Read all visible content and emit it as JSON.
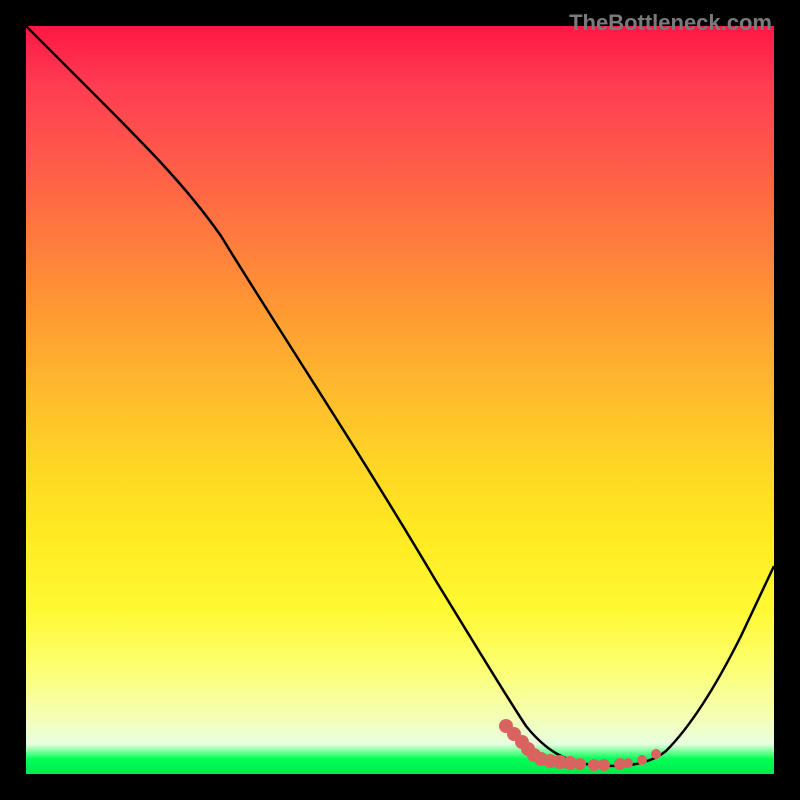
{
  "watermark": "TheBottleneck.com",
  "chart_data": {
    "type": "line",
    "title": "",
    "xlabel": "",
    "ylabel": "",
    "xlim": [
      0,
      100
    ],
    "ylim": [
      0,
      100
    ],
    "series": [
      {
        "name": "curve",
        "x": [
          0,
          8,
          18,
          30,
          45,
          58,
          64,
          70,
          73,
          76,
          80,
          84,
          88,
          92,
          100
        ],
        "y": [
          100,
          92,
          84,
          72,
          52,
          32,
          22,
          10,
          5,
          2,
          1,
          1,
          4,
          10,
          28
        ]
      }
    ],
    "trough_markers": {
      "x": [
        64,
        66,
        68,
        70,
        72,
        73,
        74,
        76,
        78,
        80,
        82,
        83
      ],
      "y": [
        5,
        4,
        3,
        3,
        2.5,
        2,
        1.5,
        1,
        1,
        1,
        1.5,
        2
      ]
    },
    "gradient_stops": [
      {
        "pos": 0,
        "color": "#ff1744"
      },
      {
        "pos": 50,
        "color": "#ffd426"
      },
      {
        "pos": 85,
        "color": "#fdff6a"
      },
      {
        "pos": 98,
        "color": "#00ff55"
      },
      {
        "pos": 100,
        "color": "#00e850"
      }
    ]
  }
}
